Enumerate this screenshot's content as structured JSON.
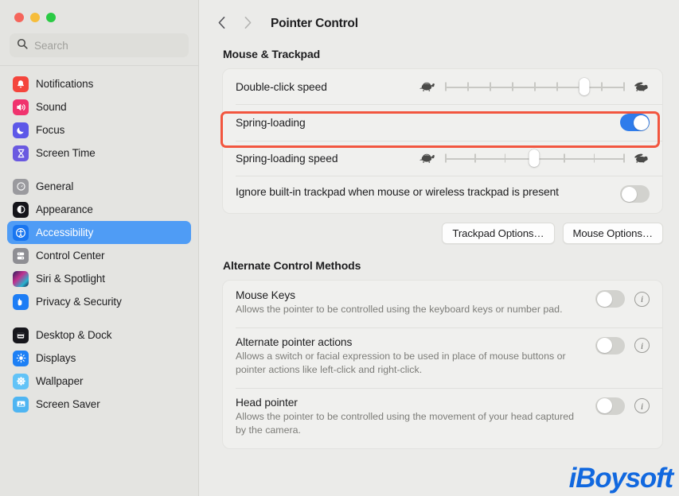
{
  "window": {
    "traffic_lights": [
      "close",
      "minimize",
      "zoom"
    ],
    "colors": {
      "close": "#f5655b",
      "minimize": "#f6bd3b",
      "zoom": "#2aca44",
      "accent": "#4f9cf5",
      "toggle_on": "#2f7ceb",
      "highlight": "#f2563f",
      "watermark": "#1168df"
    }
  },
  "sidebar": {
    "search": {
      "placeholder": "Search",
      "value": "",
      "icon": "search-icon"
    },
    "groups": [
      {
        "items": [
          {
            "label": "Notifications",
            "icon": "notifications-icon",
            "selected": false
          },
          {
            "label": "Sound",
            "icon": "sound-icon",
            "selected": false
          },
          {
            "label": "Focus",
            "icon": "focus-icon",
            "selected": false
          },
          {
            "label": "Screen Time",
            "icon": "screen-time-icon",
            "selected": false
          }
        ]
      },
      {
        "items": [
          {
            "label": "General",
            "icon": "general-icon",
            "selected": false
          },
          {
            "label": "Appearance",
            "icon": "appearance-icon",
            "selected": false
          },
          {
            "label": "Accessibility",
            "icon": "accessibility-icon",
            "selected": true
          },
          {
            "label": "Control Center",
            "icon": "control-center-icon",
            "selected": false
          },
          {
            "label": "Siri & Spotlight",
            "icon": "siri-icon",
            "selected": false
          },
          {
            "label": "Privacy & Security",
            "icon": "privacy-icon",
            "selected": false
          }
        ]
      },
      {
        "items": [
          {
            "label": "Desktop & Dock",
            "icon": "desktop-dock-icon",
            "selected": false
          },
          {
            "label": "Displays",
            "icon": "displays-icon",
            "selected": false
          },
          {
            "label": "Wallpaper",
            "icon": "wallpaper-icon",
            "selected": false
          },
          {
            "label": "Screen Saver",
            "icon": "screen-saver-icon",
            "selected": false
          }
        ]
      }
    ]
  },
  "toolbar": {
    "back_icon": "chevron-left-icon",
    "forward_icon": "chevron-right-icon",
    "title": "Pointer Control"
  },
  "sections": [
    {
      "header": "Mouse & Trackpad",
      "rows": [
        {
          "type": "slider",
          "label": "Double-click speed",
          "left_icon": "turtle-icon",
          "right_icon": "rabbit-icon",
          "ticks": 9,
          "value_percent": 78
        },
        {
          "type": "toggle",
          "label": "Spring-loading",
          "toggle_state": "on",
          "highlighted": true
        },
        {
          "type": "slider",
          "label": "Spring-loading speed",
          "left_icon": "turtle-icon",
          "right_icon": "rabbit-icon",
          "ticks": 7,
          "value_percent": 50
        },
        {
          "type": "toggle-wrap",
          "label": "Ignore built-in trackpad when mouse or wireless trackpad is present",
          "toggle_state": "off"
        }
      ],
      "buttons": [
        {
          "label": "Trackpad Options…"
        },
        {
          "label": "Mouse Options…"
        }
      ]
    },
    {
      "header": "Alternate Control Methods",
      "rows": [
        {
          "type": "desc-toggle",
          "title": "Mouse Keys",
          "description": "Allows the pointer to be controlled using the keyboard keys or number pad.",
          "toggle_state": "off",
          "info": "i"
        },
        {
          "type": "desc-toggle",
          "title": "Alternate pointer actions",
          "description": "Allows a switch or facial expression to be used in place of mouse buttons or pointer actions like left-click and right-click.",
          "toggle_state": "off",
          "info": "i"
        },
        {
          "type": "desc-toggle",
          "title": "Head pointer",
          "description": "Allows the pointer to be controlled using the movement of your head captured by the camera.",
          "toggle_state": "off",
          "info": "i"
        }
      ]
    }
  ],
  "watermark": {
    "text": "iBoysoft"
  }
}
